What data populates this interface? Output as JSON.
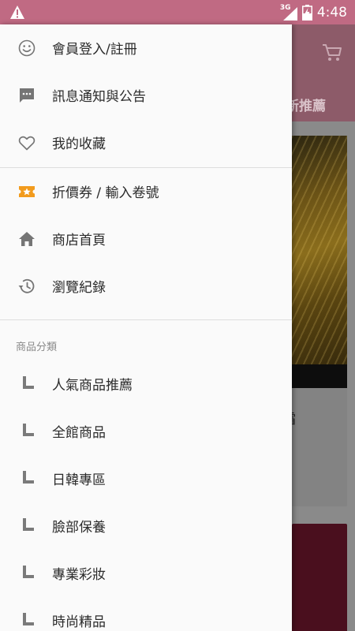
{
  "status_bar": {
    "network_type": "3G",
    "time": "4:48"
  },
  "background_app": {
    "tab_partial": "新推薦",
    "card_title_partial": "霜"
  },
  "drawer": {
    "top_items": [
      {
        "label": "會員登入/註冊",
        "icon": "smiley-icon"
      },
      {
        "label": "訊息通知與公告",
        "icon": "message-icon"
      },
      {
        "label": "我的收藏",
        "icon": "heart-icon"
      }
    ],
    "mid_items": [
      {
        "label": "折價券 / 輸入卷號",
        "icon": "ticket-icon"
      },
      {
        "label": "商店首頁",
        "icon": "home-icon"
      },
      {
        "label": "瀏覽紀錄",
        "icon": "history-icon"
      }
    ],
    "categories_header": "商品分類",
    "categories": [
      {
        "label": "人氣商品推薦"
      },
      {
        "label": "全館商品"
      },
      {
        "label": "日韓專區"
      },
      {
        "label": "臉部保養"
      },
      {
        "label": "專業彩妝"
      },
      {
        "label": "時尚精品"
      }
    ]
  },
  "colors": {
    "status_bar": "#c06a83",
    "accent_ticket": "#f29b1d",
    "icon_gray": "#757575",
    "text": "#2b2b2b"
  }
}
